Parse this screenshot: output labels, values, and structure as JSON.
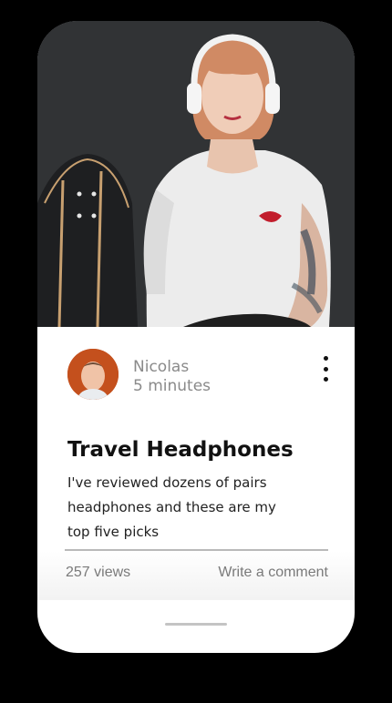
{
  "post": {
    "author_name": "Nicolas",
    "author_time": "5 minutes",
    "title": "Travel Headphones",
    "body": "I've reviewed dozens of pairs headphones and these are my top five picks"
  },
  "stats": {
    "views": "257 views",
    "comment_label": "Write a comment"
  },
  "icons": {
    "more": "more-vertical-icon"
  },
  "colors": {
    "phone_bg": "#ffffff",
    "device_frame": "#000000",
    "avatar_bg": "#c4501d",
    "title_text": "#111111",
    "meta_text": "#8a8a8a",
    "divider": "#b9b9b9"
  }
}
